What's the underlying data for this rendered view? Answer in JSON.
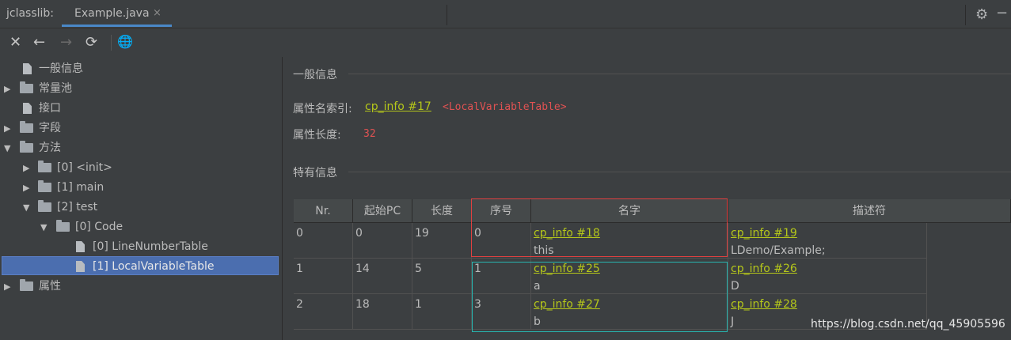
{
  "window": {
    "tool_title": "jclasslib:",
    "tab_label": "Example.java",
    "tab_close": "×"
  },
  "toolbar": {
    "close": "✕",
    "back": "←",
    "forward": "→",
    "refresh": "⟳",
    "web": "🌐",
    "settings": "⚙",
    "minimize": "−"
  },
  "tree": {
    "general": "一般信息",
    "constant_pool": "常量池",
    "interfaces": "接口",
    "fields": "字段",
    "methods": "方法",
    "method0": "[0] <init>",
    "method1": "[1] main",
    "method2": "[2] test",
    "code": "[0] Code",
    "lnt": "[0] LineNumberTable",
    "lvt": "[1] LocalVariableTable",
    "attributes": "属性"
  },
  "general": {
    "section_title": "一般信息",
    "name_index_label": "属性名索引:",
    "name_index_link": "cp_info #17",
    "name_index_value": "<LocalVariableTable>",
    "length_label": "属性长度:",
    "length_value": "32",
    "specific_title": "特有信息"
  },
  "table": {
    "headers": [
      "Nr.",
      "起始PC",
      "长度",
      "序号",
      "名字",
      "描述符"
    ],
    "rows": [
      {
        "nr": "0",
        "start_pc": "0",
        "length": "19",
        "index": "0",
        "name_link": "cp_info #18",
        "name": "this",
        "desc_link": "cp_info #19",
        "desc": "LDemo/Example;"
      },
      {
        "nr": "1",
        "start_pc": "14",
        "length": "5",
        "index": "1",
        "name_link": "cp_info #25",
        "name": "a",
        "desc_link": "cp_info #26",
        "desc": "D"
      },
      {
        "nr": "2",
        "start_pc": "18",
        "length": "1",
        "index": "3",
        "name_link": "cp_info #27",
        "name": "b",
        "desc_link": "cp_info #28",
        "desc": "J"
      }
    ]
  },
  "watermark": "https://blog.csdn.net/qq_45905596"
}
